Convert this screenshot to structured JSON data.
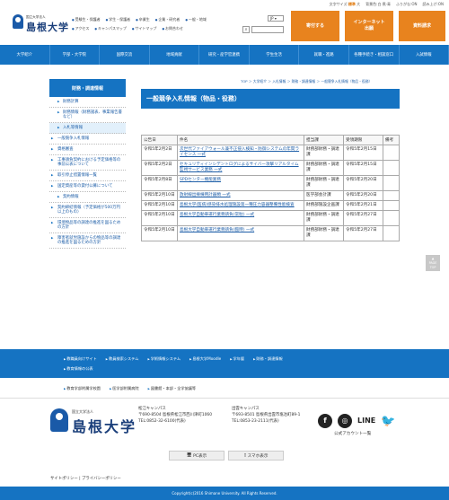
{
  "top": {
    "fontsize_label": "文字サイズ:",
    "fontsize_opts": [
      "標準",
      "大"
    ],
    "contrast_label": "背景色:白·黒·青",
    "furigana": "ふりがな:ON",
    "readout": "読み上げ:ON"
  },
  "header": {
    "small": "国立大学法人",
    "name": "島根大学",
    "nav1": [
      "受験生・保護者",
      "学生・保護者",
      "卒業生",
      "企業・研究者",
      "一般・地域"
    ],
    "nav2": [
      "アクセス",
      "キャンパスマップ",
      "サイトマップ",
      "お問合わせ"
    ],
    "lang": "JP",
    "btn_donate": "寄付する",
    "btn_apply_1": "インターネット",
    "btn_apply_2": "出願",
    "btn_docs": "資料請求"
  },
  "mainnav": [
    "大学紹介",
    "学部・大学院",
    "国際交流",
    "地域貢献",
    "研究・産学官連携",
    "学生生活",
    "就職・進路",
    "各種手続き・相談窓口",
    "入試情報"
  ],
  "breadcrumb": "TOP ＞ 大学紹介 ＞ 入札情報 ＞ 財務・調達情報 ＞ 一般競争入札情報（物品・役務）",
  "sidebar": {
    "head": "財務・調達情報",
    "items": [
      {
        "label": "財務計算",
        "sub": true
      },
      {
        "label": "財務情報（財務諸表、事業報告書など）",
        "sub": true
      },
      {
        "label": "入札等情報",
        "sub": true,
        "active": true
      },
      {
        "label": "一般競争入札情報",
        "sub": false
      },
      {
        "label": "資格審査",
        "sub": false
      },
      {
        "label": "工事請負契約における予定価格等の事前公表について",
        "sub": false
      },
      {
        "label": "取引停止措置情報一覧",
        "sub": false
      },
      {
        "label": "国定資産等の貸付公募について",
        "sub": false
      },
      {
        "label": "契約情報",
        "sub": true
      },
      {
        "label": "契約締結情報（予定価格が500万円以上のもの）",
        "sub": false
      },
      {
        "label": "環境物品等の調達の推進を図るための方針",
        "sub": false
      },
      {
        "label": "障害者就労施設からの物品等の調達の推進を図るための方針",
        "sub": false
      }
    ]
  },
  "title": "一般競争入札情報（物品・役務）",
  "table": {
    "headers": [
      "公告日",
      "件名",
      "担当課",
      "受領期限",
      "備考"
    ],
    "rows": [
      {
        "date": "令和5年2月2日",
        "subject": "次世代ファイアウォール兼不正侵入検知・防御システムの年間ライセンス 一式",
        "dept": "財務部財務・調達課",
        "deadline": "令和5年2月15日",
        "note": ""
      },
      {
        "date": "令和5年2月2日",
        "subject": "セキュリティインシデントログによるサイバー攻撃リアルタイム監視サービス業務 一式",
        "dept": "財務部財務・調達課",
        "deadline": "令和5年2月15日",
        "note": ""
      },
      {
        "date": "令和5年2月8日",
        "subject": "SPDセンター機能業務",
        "dept": "財務部財務・調達課",
        "deadline": "令和5年2月20日",
        "note": ""
      },
      {
        "date": "令和5年2月10日",
        "subject": "放射線出療棟用計器類 一式",
        "dept": "医学部会計課",
        "deadline": "令和5年2月20日",
        "note": ""
      },
      {
        "date": "令和5年2月10日",
        "subject": "島根大学(医病)感染排水処理施設第一種圧力容器整備性能検査",
        "dept": "財務部施設企画課",
        "deadline": "令和5年2月21日",
        "note": ""
      },
      {
        "date": "令和5年2月10日",
        "subject": "島根大学自動車運行業務請負(常駐) 一式",
        "dept": "財務部財務・調達課",
        "deadline": "令和5年2月27日",
        "note": ""
      },
      {
        "date": "令和5年2月10日",
        "subject": "島根大学自動車運行業務請負(臨時) 一式",
        "dept": "財務部財務・調達課",
        "deadline": "令和5年2月27日",
        "note": ""
      }
    ]
  },
  "pagetop": "PAGE TOP",
  "footer": {
    "links1": [
      "教職員向けサイト",
      "教員検索システム",
      "学術情報システム",
      "島根大学Moodle",
      "学年暦",
      "財務・調達情報"
    ],
    "links1b": [
      "教育情報の公表"
    ],
    "links2": [
      "教育学部附属学校園",
      "医学部附属病院",
      "図書館・本部・全学協議等"
    ],
    "small": "国立大学法人",
    "name": "島根大学",
    "campus1": [
      "松江キャンパス",
      "〒690-8504 島根県松江市西川津町1060",
      "TEL:0852-32-6100(代表)"
    ],
    "campus2": [
      "出雲キャンパス",
      "〒693-8501 島根県出雲市塩冶町89-1",
      "TEL:0853-23-2111(代表)"
    ],
    "line": "LINE",
    "official": "公式アカウント一覧",
    "pc": "PC表示",
    "sp": "スマホ表示",
    "policy": "サイトポリシー | プライバシーポリシー",
    "copyright": "Copyright(c)2016 Shimane University. All Rights Reserved."
  }
}
